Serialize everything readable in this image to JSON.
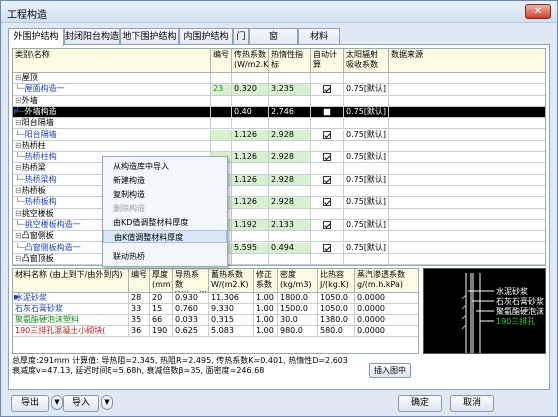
{
  "window": {
    "title": "工程构造",
    "close_glyph": "✕"
  },
  "tabs": [
    "外围护结构",
    "封闭阳台构造",
    "地下围护结构",
    "内围护结构",
    "门",
    "窗",
    "材料"
  ],
  "upper_table": {
    "headers": [
      "类别\\名称",
      "编号",
      "传热系数 (W/m2.K)",
      "热惰性指标",
      "自动计算",
      "太阳辐射 吸收系数",
      "数据来源"
    ],
    "rows": [
      {
        "kind": "group",
        "name": "屋顶"
      },
      {
        "kind": "item",
        "name": "屋面构造一",
        "code": "23",
        "k": "0.320",
        "d": "3.235",
        "auto": true,
        "rho": "0.75[默认]"
      },
      {
        "kind": "group",
        "name": "外墙"
      },
      {
        "kind": "item",
        "name": "外墙构造",
        "code": "",
        "k": "0.40",
        "d": "2.746",
        "auto": false,
        "rho": "0.75[默认]",
        "selected": true
      },
      {
        "kind": "group",
        "name": "阳台隔墙"
      },
      {
        "kind": "item",
        "name": "阳台隔墙",
        "code": "",
        "k": "1.126",
        "d": "2.928",
        "auto": true,
        "rho": "0.75[默认]"
      },
      {
        "kind": "group",
        "name": "热桥柱"
      },
      {
        "kind": "item",
        "name": "热桥柱构",
        "code": "",
        "k": "1.126",
        "d": "2.928",
        "auto": true,
        "rho": "0.75[默认]"
      },
      {
        "kind": "group",
        "name": "热桥梁"
      },
      {
        "kind": "item",
        "name": "热桥梁构",
        "code": "",
        "k": "1.126",
        "d": "2.928",
        "auto": true,
        "rho": "0.75[默认]"
      },
      {
        "kind": "group",
        "name": "热桥板"
      },
      {
        "kind": "item",
        "name": "热桥板构",
        "code": "",
        "k": "1.126",
        "d": "2.928",
        "auto": true,
        "rho": "0.75[默认]"
      },
      {
        "kind": "group",
        "name": "挑空楼板"
      },
      {
        "kind": "item",
        "name": "挑空楼板构造一",
        "code": "41",
        "k": "1.192",
        "d": "2.133",
        "auto": true,
        "rho": "0.75[默认]"
      },
      {
        "kind": "group",
        "name": "凸窗侧板"
      },
      {
        "kind": "item",
        "name": "凸窗侧板构造一",
        "code": "42",
        "k": "5.595",
        "d": "0.494",
        "auto": true,
        "rho": "0.75[默认]"
      },
      {
        "kind": "group",
        "name": "凸窗顶板"
      }
    ]
  },
  "context_menu": {
    "items": [
      {
        "label": "从构造库中导入",
        "disabled": false
      },
      {
        "label": "新建构造",
        "disabled": false
      },
      {
        "label": "复制构造",
        "disabled": false
      },
      {
        "label": "删除构造",
        "disabled": true
      },
      {
        "label": "由KD值调整材料厚度",
        "disabled": false
      },
      {
        "label": "由K值调整材料厚度",
        "disabled": false,
        "hover": true
      },
      {
        "label": "联动热桥",
        "disabled": false
      }
    ]
  },
  "lower_table": {
    "headers": [
      "材料名称 (由上到下/由外到内)",
      "编号",
      "厚度 (mm)",
      "导热系数 W/(m.K)",
      "蓄热系数 W/(m2.K)",
      "修正 系数",
      "密度 (kg/m3)",
      "比热容 J/(kg.K)",
      "蒸汽渗透系数 g/(m.h.kPa)"
    ],
    "rows": [
      {
        "name": "水泥砂浆",
        "code": "28",
        "thick": "20",
        "lambda": "0.930",
        "s": "11.306",
        "a": "1.00",
        "rho": "1800.0",
        "c": "1050.0",
        "mu": "0.0000",
        "color": "#1e40c0"
      },
      {
        "name": "石灰石膏砂浆",
        "code": "33",
        "thick": "15",
        "lambda": "0.760",
        "s": "9.330",
        "a": "1.00",
        "rho": "1500.0",
        "c": "1050.0",
        "mu": "0.0000",
        "color": "#1e40c0"
      },
      {
        "name": "聚氨酯硬泡沫塑料",
        "code": "35",
        "thick": "66",
        "lambda": "0.033",
        "s": "0.315",
        "a": "1.00",
        "rho": "30.0",
        "c": "1380.0",
        "mu": "0.0000",
        "color": "#1a8a1a"
      },
      {
        "name": "190三排孔混凝土小砌块(",
        "code": "36",
        "thick": "190",
        "lambda": "0.625",
        "s": "5.083",
        "a": "1.00",
        "rho": "980.0",
        "c": "580.0",
        "mu": "0.0000",
        "color": "#c01a1a"
      }
    ]
  },
  "preview_labels": [
    "水泥砂浆",
    "石灰石膏砂浆",
    "聚氨酯硬泡沫塑料",
    "190三排孔"
  ],
  "summary": {
    "line1": "总厚度:291mm  计算值: 导热阻=2.345, 热阻R=2.495, 传热系数K=0.401, 热惰性D=2.603",
    "line2": "衰减度v=47.13, 延迟时间ξ=5.68h, 衰减倍数β=35, 面密度=246.68"
  },
  "buttons": {
    "insert_figure": "插入图中",
    "export": "导出",
    "import": "导入",
    "ok": "确定",
    "cancel": "取消",
    "arrow": "▼"
  }
}
